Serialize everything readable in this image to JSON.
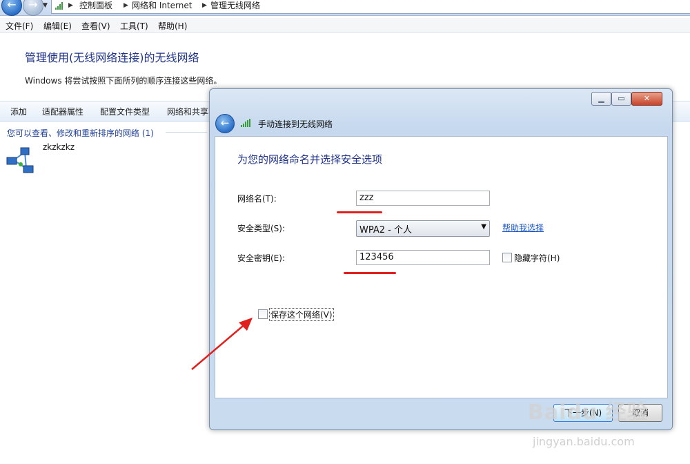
{
  "address_bar": {
    "crumbs": [
      "控制面板",
      "网络和 Internet",
      "管理无线网络"
    ]
  },
  "menu": [
    "文件(F)",
    "编辑(E)",
    "查看(V)",
    "工具(T)",
    "帮助(H)"
  ],
  "page": {
    "title": "管理使用(无线网络连接)的无线网络",
    "description": "Windows 将尝试按照下面所列的顺序连接这些网络。"
  },
  "toolbar": [
    "添加",
    "适配器属性",
    "配置文件类型",
    "网络和共享"
  ],
  "network_list": {
    "group_header": "您可以查看、修改和重新排序的网络 (1)",
    "items": [
      {
        "name": "zkzkzkz"
      }
    ]
  },
  "dialog": {
    "title": "手动连接到无线网络",
    "heading": "为您的网络命名并选择安全选项",
    "network_name_label": "网络名(T):",
    "network_name_value": "zzz",
    "security_type_label": "安全类型(S):",
    "security_type_value": "WPA2 - 个人",
    "help_link": "帮助我选择",
    "security_key_label": "安全密钥(E):",
    "security_key_value": "123456",
    "hide_chars_label": "隐藏字符(H)",
    "save_network_label": "保存这个网络(V)",
    "next_button": "下一步(N)",
    "cancel_button": "取消"
  },
  "watermark": {
    "text": "Baidu 经验",
    "url": "jingyan.baidu.com"
  },
  "colors": {
    "link": "#1a57c8",
    "title_blue": "#1e3287",
    "annotation_red": "#e0201c"
  },
  "icons": [
    "back-arrow-icon",
    "forward-arrow-icon",
    "chevron-down-icon",
    "signal-bars-icon",
    "network-icon",
    "minimize-icon",
    "maximize-icon",
    "close-icon"
  ]
}
